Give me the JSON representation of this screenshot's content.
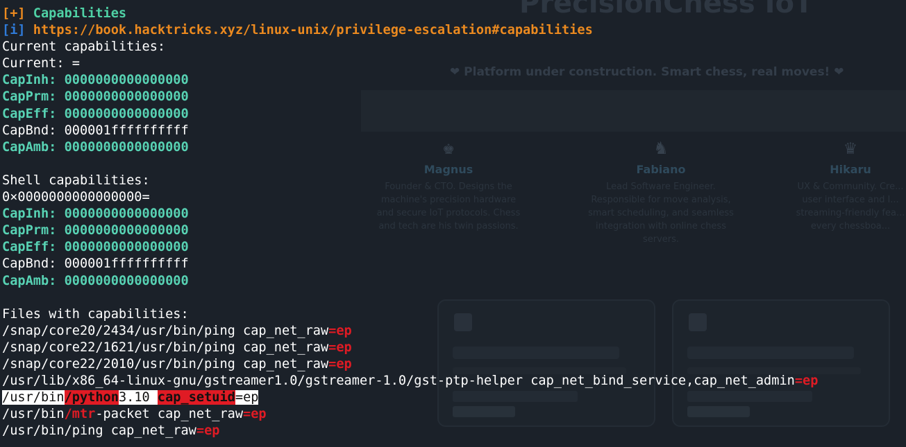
{
  "background_page": {
    "title": "PrecisionChess IoT",
    "tagline": "❤ Platform under construction. Smart chess, real moves! ❤",
    "team": [
      {
        "name": "Magnus",
        "role": "Founder & CTO. Designs the machine's precision hardware and secure IoT protocols. Chess and tech are his twin passions."
      },
      {
        "name": "Fabiano",
        "role": "Lead Software Engineer. Responsible for move analysis, smart scheduling, and seamless integration with online chess servers."
      },
      {
        "name": "Hikaru",
        "role": "UX & Community. Cre... user interface and l... streaming-friendly fea... every chessboa..."
      }
    ]
  },
  "terminal": {
    "section_header": {
      "bracket": "[+]",
      "text": "Capabilities"
    },
    "info_line": {
      "bracket": "[i]",
      "url": "https://book.hacktricks.xyz/linux-unix/privilege-escalation#capabilities"
    },
    "current_title": "Current capabilities:",
    "current_value": "Current: =",
    "current_caps": [
      {
        "name": "CapInh:",
        "value": "0000000000000000",
        "highlight": true
      },
      {
        "name": "CapPrm:",
        "value": "0000000000000000",
        "highlight": true
      },
      {
        "name": "CapEff:",
        "value": "0000000000000000",
        "highlight": true
      },
      {
        "name": "CapBnd:",
        "value": "000001ffffffffff",
        "highlight": false
      },
      {
        "name": "CapAmb:",
        "value": "0000000000000000",
        "highlight": true
      }
    ],
    "shell_title": "Shell capabilities:",
    "shell_value": "0×0000000000000000=",
    "shell_caps": [
      {
        "name": "CapInh:",
        "value": "0000000000000000",
        "highlight": true
      },
      {
        "name": "CapPrm:",
        "value": "0000000000000000",
        "highlight": true
      },
      {
        "name": "CapEff:",
        "value": "0000000000000000",
        "highlight": true
      },
      {
        "name": "CapBnd:",
        "value": "000001ffffffffff",
        "highlight": false
      },
      {
        "name": "CapAmb:",
        "value": "0000000000000000",
        "highlight": true
      }
    ],
    "files_title": "Files with capabilities:",
    "files": {
      "f1": {
        "path": "/snap/core20/2434/usr/bin/ping cap_net_raw",
        "suffix": "=ep"
      },
      "f2": {
        "path": "/snap/core22/1621/usr/bin/ping cap_net_raw",
        "suffix": "=ep"
      },
      "f3": {
        "path": "/snap/core22/2010/usr/bin/ping cap_net_raw",
        "suffix": "=ep"
      },
      "f4": {
        "path": "/usr/lib/x86_64-linux-gnu/gstreamer1.0/gstreamer-1.0/gst-ptp-helper cap_net_bind_service,cap_net_admin",
        "suffix": "=ep"
      },
      "f5": {
        "p1": "/usr/bin",
        "p2": "/python",
        "p3": "3.10 ",
        "p4": "cap_setuid",
        "p5": "=ep"
      },
      "f6": {
        "p1": "/usr/bin",
        "p2": "/mtr",
        "p3": "-packet cap_net_raw",
        "p4": "=ep"
      },
      "f7": {
        "path": "/usr/bin/ping cap_net_raw",
        "suffix": "=ep"
      }
    }
  },
  "colors": {
    "background": "#1b2129",
    "text": "#ffffff",
    "accent_blue": "#2f7bd9",
    "accent_orange": "#ec8a1f",
    "accent_teal": "#4fd1a5",
    "alert_red": "#e01b24"
  }
}
